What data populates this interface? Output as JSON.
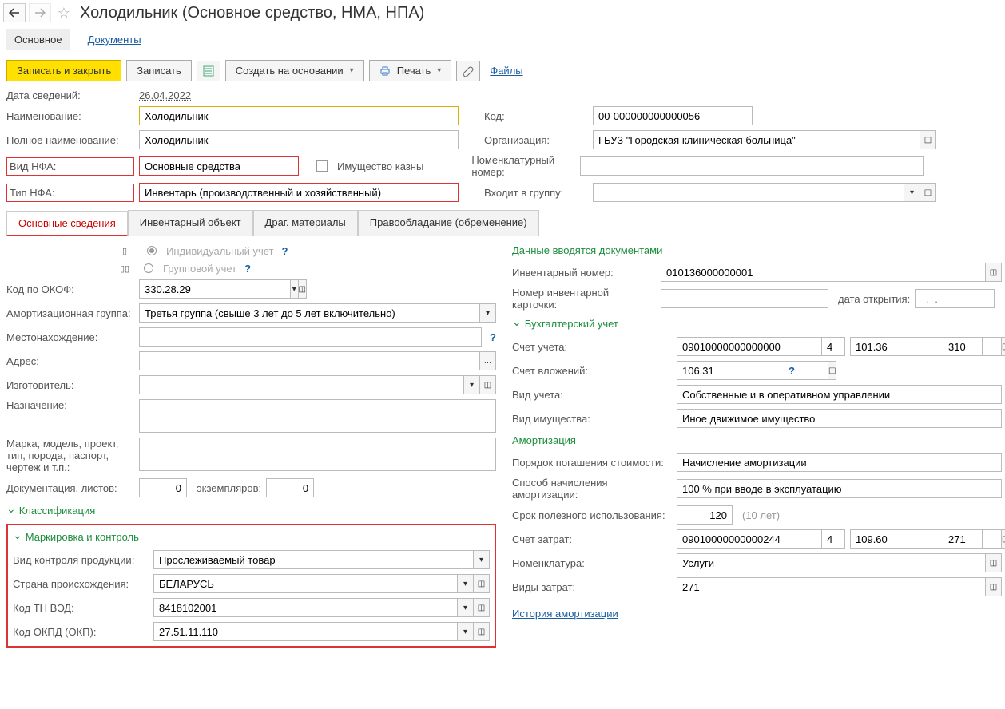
{
  "header": {
    "title": "Холодильник (Основное средство, НМА, НПА)"
  },
  "navTabs": {
    "main": "Основное",
    "docs": "Документы"
  },
  "toolbar": {
    "saveClose": "Записать и закрыть",
    "save": "Записать",
    "createBased": "Создать на основании",
    "print": "Печать",
    "files": "Файлы"
  },
  "fields": {
    "dateLabel": "Дата сведений:",
    "dateValue": "26.04.2022",
    "nameLabel": "Наименование:",
    "nameValue": "Холодильник",
    "codeLabel": "Код:",
    "codeValue": "00-000000000000056",
    "fullNameLabel": "Полное наименование:",
    "fullNameValue": "Холодильник",
    "orgLabel": "Организация:",
    "orgValue": "ГБУЗ \"Городская клиническая больница\"",
    "nfaKindLabel": "Вид НФА:",
    "nfaKindValue": "Основные средства",
    "treasuryLabel": "Имущество казны",
    "nomNumLabel": "Номенклатурный номер:",
    "nomNumValue": "",
    "nfaTypeLabel": "Тип НФА:",
    "nfaTypeValue": "Инвентарь (производственный и хозяйственный)",
    "groupLabel": "Входит в группу:",
    "groupValue": ""
  },
  "tabs": {
    "t1": "Основные сведения",
    "t2": "Инвентарный объект",
    "t3": "Драг. материалы",
    "t4": "Правообладание (обременение)"
  },
  "left": {
    "individualAcct": "Индивидуальный учет",
    "groupAcct": "Групповой учет",
    "okofLabel": "Код по ОКОФ:",
    "okofValue": "330.28.29",
    "amortGroupLabel": "Амортизационная группа:",
    "amortGroupValue": "Третья группа (свыше 3 лет до 5 лет включительно)",
    "locationLabel": "Местонахождение:",
    "addressLabel": "Адрес:",
    "makerLabel": "Изготовитель:",
    "purposeLabel": "Назначение:",
    "modelLabel": "Марка, модель, проект, тип, порода, паспорт, чертеж и т.п.:",
    "docsLabel": "Документация, листов:",
    "docsValue": "0",
    "copiesLabel": "экземпляров:",
    "copiesValue": "0",
    "classHeader": "Классификация",
    "markingHeader": "Маркировка и контроль",
    "controlKindLabel": "Вид контроля продукции:",
    "controlKindValue": "Прослеживаемый товар",
    "countryLabel": "Страна происхождения:",
    "countryValue": "БЕЛАРУСЬ",
    "tnvedLabel": "Код ТН ВЭД:",
    "tnvedValue": "8418102001",
    "okpdLabel": "Код ОКПД (ОКП):",
    "okpdValue": "27.51.11.110"
  },
  "right": {
    "docDataHeader": "Данные вводятся документами",
    "invNumLabel": "Инвентарный номер:",
    "invNumValue": "010136000000001",
    "cardNumLabel": "Номер инвентарной карточки:",
    "openDateLabel": "дата открытия:",
    "openDatePlaceholder": "  .  .    ",
    "accountingHeader": "Бухгалтерский учет",
    "acctLabel": "Счет учета:",
    "acctValue": "09010000000000000",
    "acctExtra1": "4",
    "acctExtra2": "101.36",
    "acctExtra3": "310",
    "investAcctLabel": "Счет вложений:",
    "investAcctValue": "106.31",
    "acctKindLabel": "Вид учета:",
    "acctKindValue": "Собственные и в оперативном управлении",
    "propKindLabel": "Вид имущества:",
    "propKindValue": "Иное движимое имущество",
    "amortHeader": "Амортизация",
    "repayLabel": "Порядок погашения стоимости:",
    "repayValue": "Начисление амортизации",
    "methodLabel": "Способ начисления амортизации:",
    "methodValue": "100 % при вводе в эксплуатацию",
    "usefulLabel": "Срок полезного использования:",
    "usefulValue": "120",
    "usefulHint": "(10 лет)",
    "costAcctLabel": "Счет затрат:",
    "costAcctValue": "09010000000000244",
    "costExtra1": "4",
    "costExtra2": "109.60",
    "costExtra3": "271",
    "nomLabel": "Номенклатура:",
    "nomValue": "Услуги",
    "costKindLabel": "Виды затрат:",
    "costKindValue": "271",
    "historyLink": "История амортизации"
  }
}
